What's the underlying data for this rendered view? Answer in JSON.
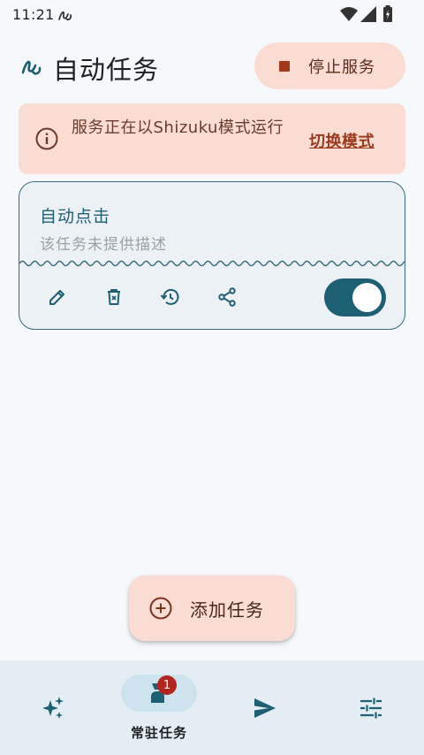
{
  "status_bar": {
    "time": "11:21",
    "icons": [
      "automation-app-icon",
      "wifi-icon",
      "cell-signal-icon",
      "battery-icon"
    ]
  },
  "header": {
    "title": "自动任务",
    "stop_button_label": "停止服务",
    "stop_button_icon": "stop-icon"
  },
  "banner": {
    "icon": "info-icon",
    "text": "服务正在以Shizuku模式运行",
    "action_label": "切换模式"
  },
  "task_card": {
    "title": "自动点击",
    "description": "该任务未提供描述",
    "actions": [
      "edit-icon",
      "delete-icon",
      "history-icon",
      "share-icon"
    ],
    "enabled": true
  },
  "fab": {
    "label": "添加任务",
    "icon": "add-circle-icon"
  },
  "bottom_nav": {
    "items": [
      {
        "icon": "sparkle-icon",
        "label": "",
        "selected": false
      },
      {
        "icon": "resident-task-icon",
        "label": "常驻任务",
        "selected": true,
        "badge": "1"
      },
      {
        "icon": "send-icon",
        "label": "",
        "selected": false
      },
      {
        "icon": "settings-tune-icon",
        "label": "",
        "selected": false
      }
    ]
  },
  "colors": {
    "accent": "#1d5f73",
    "warning_bg": "#fbdcd2",
    "warning_text": "#9a3a1e",
    "badge": "#b3261e"
  }
}
